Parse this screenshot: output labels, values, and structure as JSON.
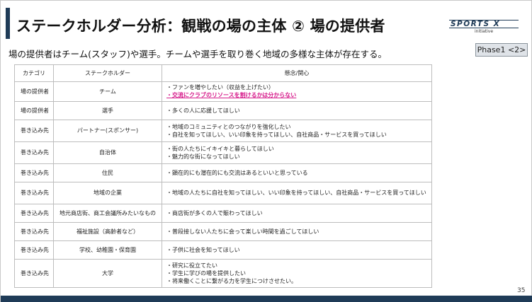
{
  "title": "ステークホルダー分析：観戦の場の主体 ② 場の提供者",
  "logo": {
    "main": "SPORTS X",
    "sub": "initiative"
  },
  "phase_badge": "Phase1 <2>",
  "subtitle": "場の提供者はチーム(スタッフ)や選手。チームや選手を取り巻く地域の多様な主体が存在する。",
  "table": {
    "headers": [
      "カテゴリ",
      "ステークホルダー",
      "懸念/関心"
    ],
    "rows": [
      {
        "category": "場の提供者",
        "stakeholder": "チーム",
        "concerns": [
          {
            "text": "・ファンを増やしたい（収益を上げたい）"
          },
          {
            "text": "・交流にクラブのリソースを割けるかは分からない",
            "highlight": true
          }
        ]
      },
      {
        "category": "場の提供者",
        "stakeholder": "選手",
        "concerns": [
          {
            "text": "・多くの人に応援してほしい"
          }
        ]
      },
      {
        "category": "巻き込み先",
        "stakeholder": "パートナー(スポンサー)",
        "concerns": [
          {
            "text": "・地域のコミュニティとのつながりを強化したい"
          },
          {
            "text": "・自社を知ってほしい、いい印象を持ってほしい、自社商品・サービスを買ってほしい"
          }
        ]
      },
      {
        "category": "巻き込み先",
        "stakeholder": "自治体",
        "concerns": [
          {
            "text": "・街の人たちにイキイキと暮らしてほしい"
          },
          {
            "text": "・魅力的な街になってほしい"
          }
        ]
      },
      {
        "category": "巻き込み先",
        "stakeholder": "住民",
        "concerns": [
          {
            "text": "・顕在的にも潜在的にも交流はあるといいと思っている"
          }
        ]
      },
      {
        "category": "巻き込み先",
        "stakeholder": "地域の企業",
        "concerns": [
          {
            "text": "・地域の人たちに自社を知ってほしい、いい印象を持ってほしい、自社商品・サービスを買ってほしい"
          }
        ]
      },
      {
        "category": "巻き込み先",
        "stakeholder": "地元商店街、商工会議所みたいなもの",
        "concerns": [
          {
            "text": "・商店街が多くの人で賑わってほしい"
          }
        ]
      },
      {
        "category": "巻き込み先",
        "stakeholder": "福祉施設（高齢者など）",
        "concerns": [
          {
            "text": "・普段接しない人たちに会って楽しい時間を過ごしてほしい"
          }
        ]
      },
      {
        "category": "巻き込み先",
        "stakeholder": "学校、幼稚園・保育園",
        "concerns": [
          {
            "text": "・子供に社会を知ってほしい"
          }
        ]
      },
      {
        "category": "巻き込み先",
        "stakeholder": "大学",
        "concerns": [
          {
            "text": "・研究に役立てたい"
          },
          {
            "text": "・学生に学びの場を提供したい"
          },
          {
            "text": "・将来働くことに繋がる力を学生につけさせたい。"
          }
        ]
      }
    ]
  },
  "page_number": "35",
  "colors": {
    "brand": "#1f3b57",
    "highlight": "#d6198a",
    "badge_bg": "#dfe3e8"
  }
}
